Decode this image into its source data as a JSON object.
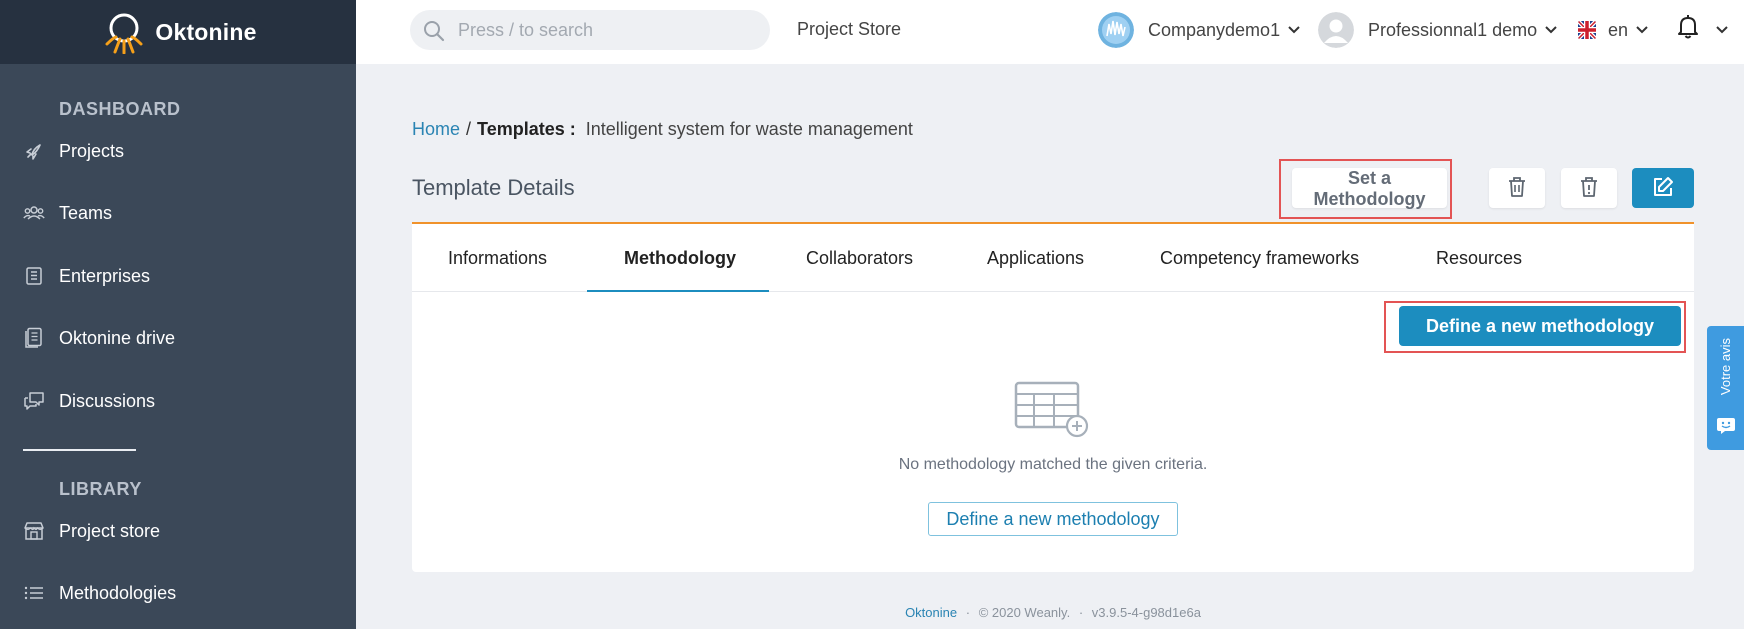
{
  "app": {
    "logo_text": "Oktonine"
  },
  "sidebar": {
    "sections": [
      {
        "title": "DASHBOARD"
      },
      {
        "title": "LIBRARY"
      }
    ],
    "items": [
      {
        "label": "Projects",
        "icon": "rocket-icon"
      },
      {
        "label": "Teams",
        "icon": "team-icon"
      },
      {
        "label": "Enterprises",
        "icon": "enterprise-icon"
      },
      {
        "label": "Oktonine drive",
        "icon": "drive-icon"
      },
      {
        "label": "Discussions",
        "icon": "discussion-icon"
      },
      {
        "label": "Project store",
        "icon": "store-icon"
      },
      {
        "label": "Methodologies",
        "icon": "list-icon"
      }
    ]
  },
  "topbar": {
    "search_placeholder": "Press / to search",
    "project_store_link": "Project Store",
    "company": "Companydemo1",
    "user": "Professionnal1 demo",
    "language": "en"
  },
  "breadcrumb": {
    "home": "Home",
    "separator": "/",
    "section": "Templates :",
    "current": "Intelligent system for waste management"
  },
  "page": {
    "title": "Template Details",
    "set_methodology_label": "Set a Methodology",
    "define_methodology_label": "Define a new methodology",
    "empty_message": "No methodology matched the given criteria.",
    "define_methodology_link": "Define a new methodology"
  },
  "tabs": [
    {
      "label": "Informations",
      "active": false
    },
    {
      "label": "Methodology",
      "active": true
    },
    {
      "label": "Collaborators",
      "active": false
    },
    {
      "label": "Applications",
      "active": false
    },
    {
      "label": "Competency frameworks",
      "active": false
    },
    {
      "label": "Resources",
      "active": false
    }
  ],
  "footer": {
    "brand": "Oktonine",
    "separator": "·",
    "copyright": "© 2020 Weanly.",
    "version": "v3.9.5-4-g98d1e6a"
  },
  "feedback": {
    "label": "Votre avis"
  },
  "colors": {
    "sidebar_bg": "#3b4858",
    "logo_bar_bg": "#263140",
    "primary": "#1c8dbf",
    "tab_accent": "#f0922b",
    "highlight": "#e35454",
    "feedback": "#3f9be0"
  }
}
